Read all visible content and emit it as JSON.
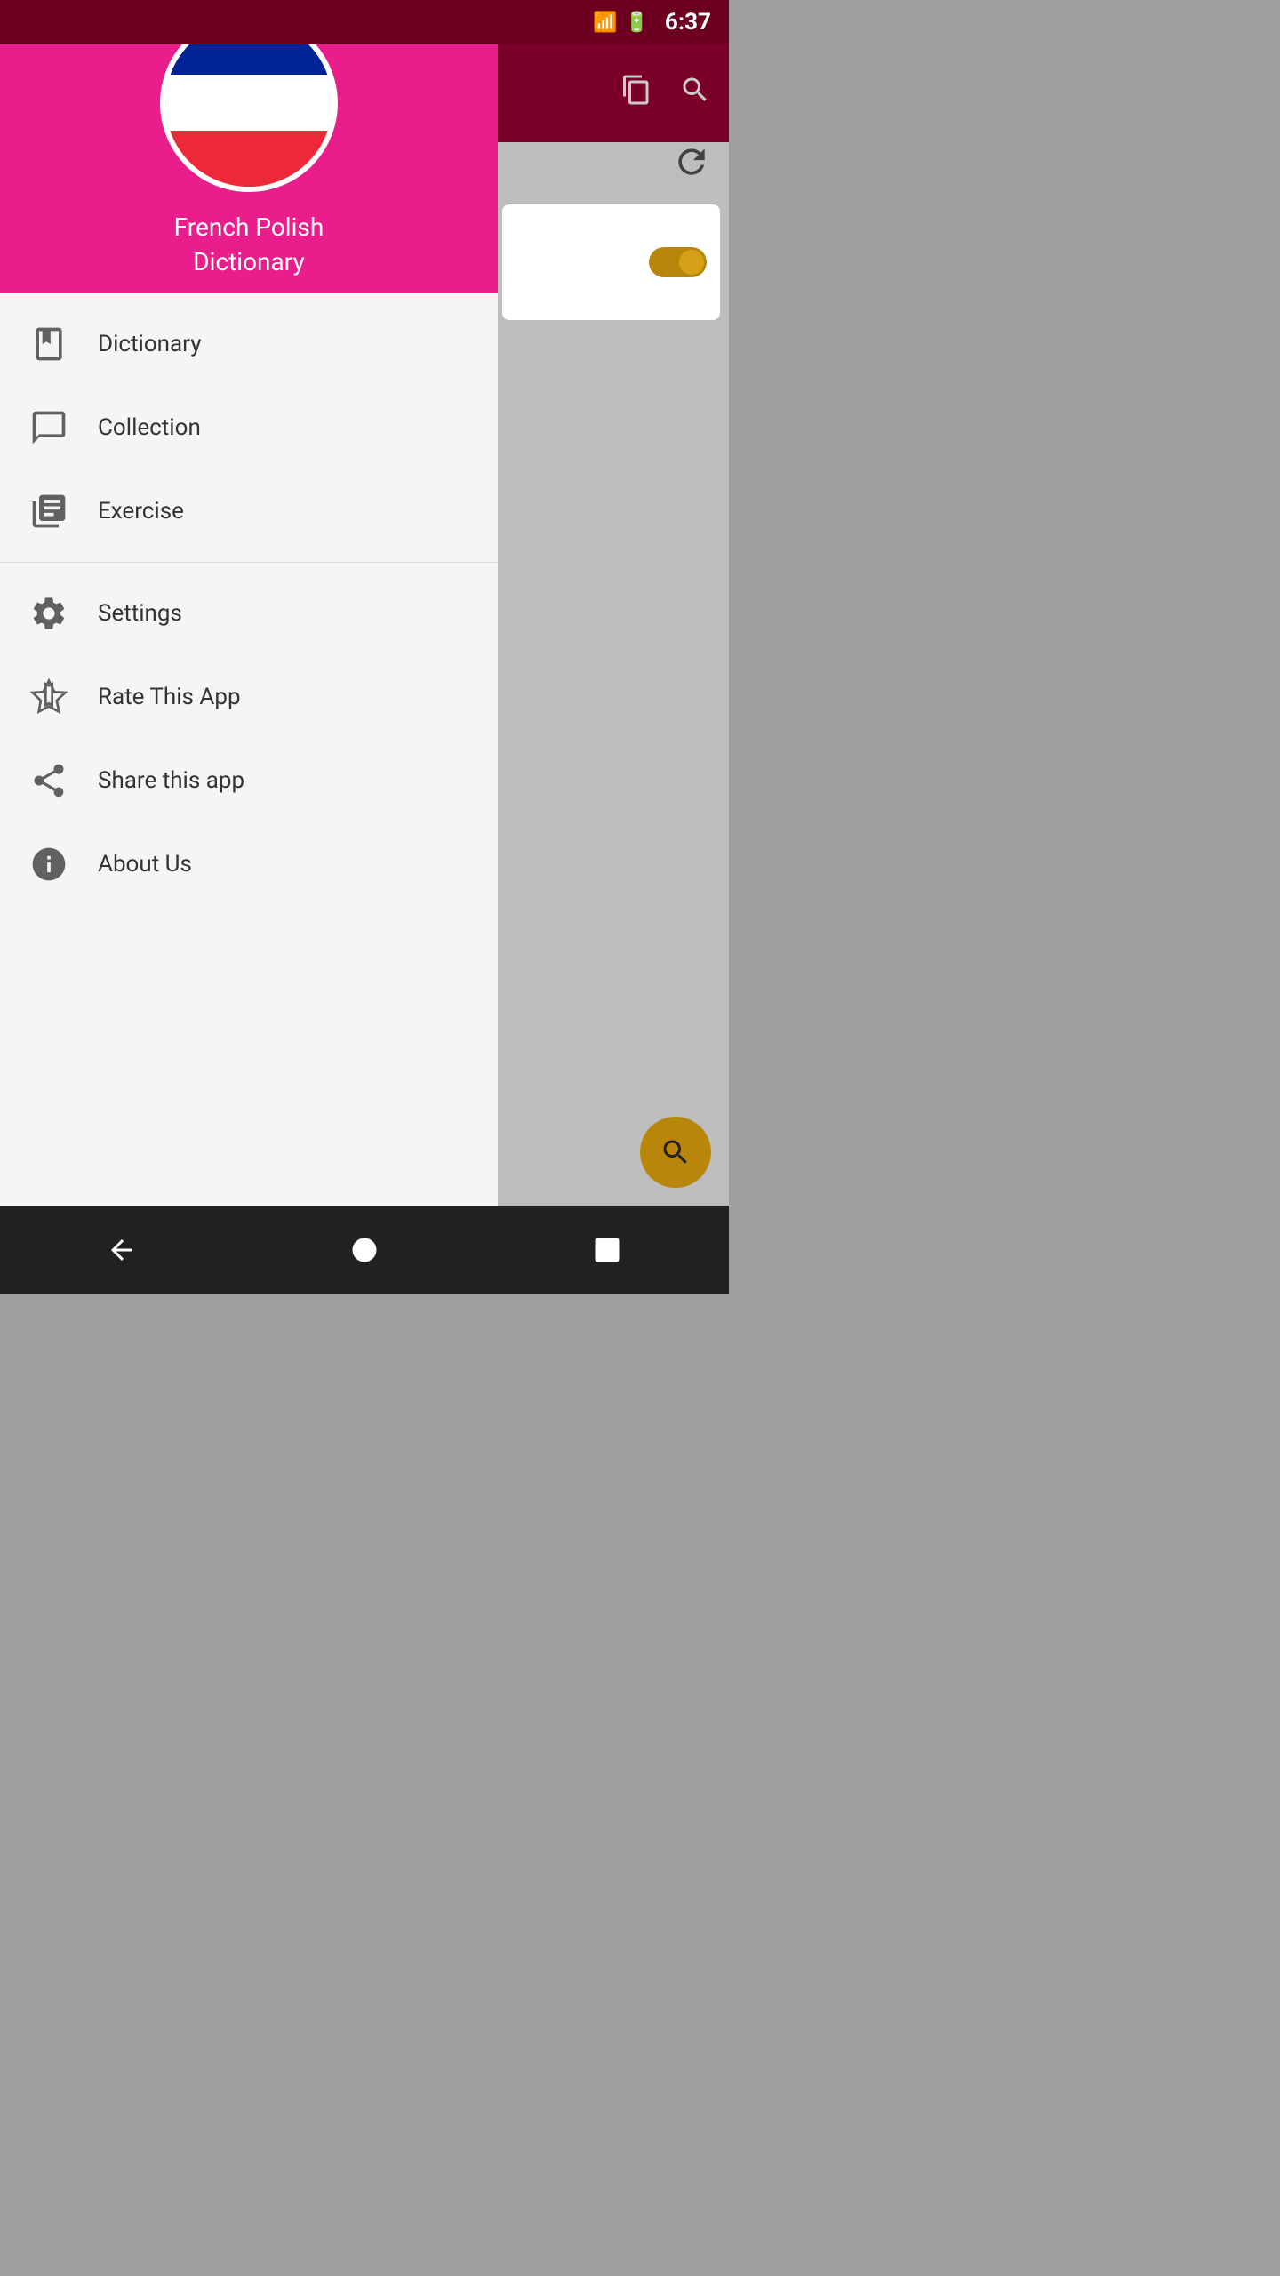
{
  "statusBar": {
    "signal": "4G",
    "battery": "⚡",
    "time": "6:37"
  },
  "appHeader": {
    "title": "French Polish",
    "subtitle": "Dictionary",
    "flagColors": {
      "blue": "#002395",
      "white": "#ffffff",
      "red": "#ED2939"
    },
    "bgColor": "#e91e8c"
  },
  "drawer": {
    "items_top": [
      {
        "id": "dictionary",
        "label": "Dictionary"
      },
      {
        "id": "collection",
        "label": "Collection"
      },
      {
        "id": "exercise",
        "label": "Exercise"
      }
    ],
    "items_bottom": [
      {
        "id": "settings",
        "label": "Settings"
      },
      {
        "id": "rate",
        "label": "Rate This App"
      },
      {
        "id": "share",
        "label": "Share this app"
      },
      {
        "id": "about",
        "label": "About Us"
      }
    ]
  },
  "actionBar": {
    "clipboardIcon": "📋",
    "searchIcon": "🔍"
  },
  "navBar": {
    "backLabel": "◀",
    "homeLabel": "⬤",
    "recentLabel": "■"
  }
}
